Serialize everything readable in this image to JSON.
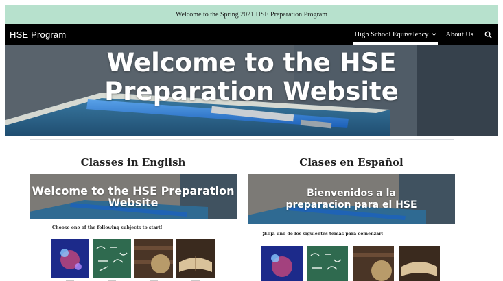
{
  "announcement": {
    "text": "Welcome to the Spring 2021 HSE Preparation Program"
  },
  "nav": {
    "site_title": "HSE Program",
    "items": [
      {
        "label": "High School Equivalency",
        "active": true,
        "has_dropdown": true
      },
      {
        "label": "About Us",
        "active": false,
        "has_dropdown": false
      }
    ],
    "search_icon": "search-icon"
  },
  "hero": {
    "title": "Welcome to the HSE Preparation Website"
  },
  "english": {
    "heading": "Classes in English",
    "banner_title": "Welcome to the HSE Preparation Website",
    "prompt": "Choose one of the following subjects to start!",
    "tiles": [
      "science-image",
      "math-image",
      "social-studies-image",
      "reading-image"
    ]
  },
  "spanish": {
    "heading": "Clases en Español",
    "banner_title": "Bienvenidos a la preparacion para el HSE",
    "prompt": "¡Elija uno de los siguientes temas para comenzar!",
    "tiles": [
      "science-image",
      "math-image",
      "social-studies-image",
      "reading-image"
    ]
  },
  "colors": {
    "announcement_bg": "#b7e1cd",
    "nav_bg": "#000000",
    "text": "#222222"
  }
}
